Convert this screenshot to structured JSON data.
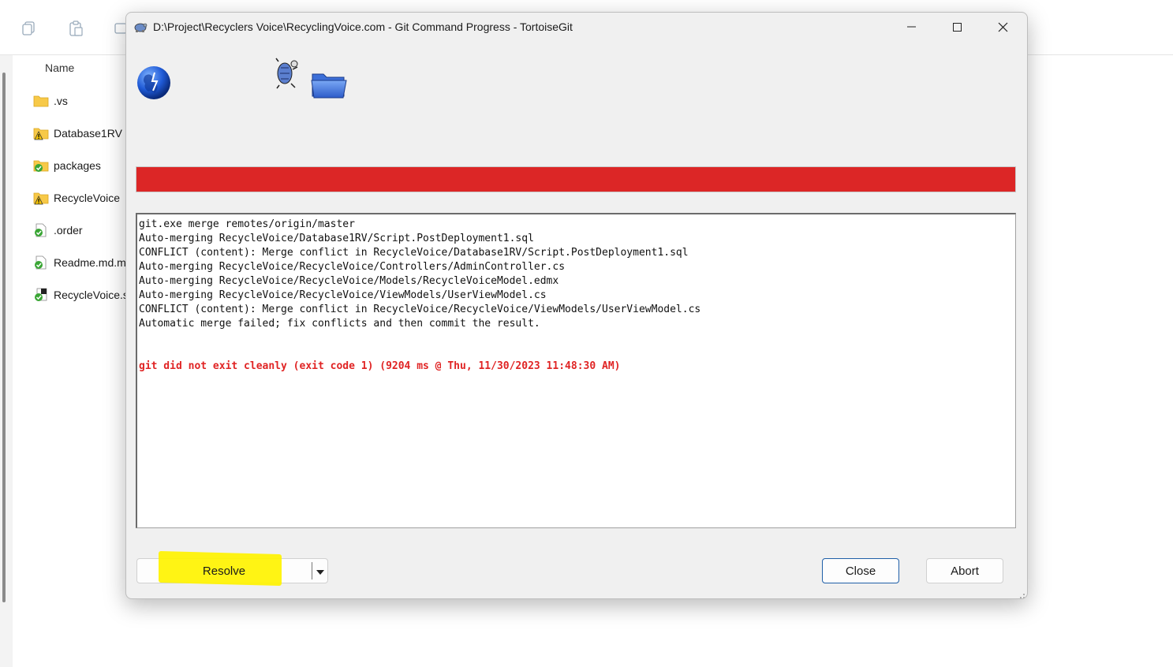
{
  "explorer": {
    "column_header": "Name",
    "files": [
      {
        "name": ".vs",
        "icon": "folder-icon"
      },
      {
        "name": "Database1RV",
        "icon": "folder-conflict-icon"
      },
      {
        "name": "packages",
        "icon": "folder-ok-icon"
      },
      {
        "name": "RecycleVoice",
        "icon": "folder-conflict-icon"
      },
      {
        "name": ".order",
        "icon": "file-ok-icon"
      },
      {
        "name": "Readme.md.m",
        "icon": "file-ok-icon"
      },
      {
        "name": "RecycleVoice.s",
        "icon": "solution-ok-icon"
      }
    ]
  },
  "dialog": {
    "title": "D:\\Project\\Recyclers Voice\\RecyclingVoice.com - Git Command Progress - TortoiseGit",
    "progress_color": "#dc2626",
    "log_lines": [
      "git.exe merge remotes/origin/master",
      "Auto-merging RecycleVoice/Database1RV/Script.PostDeployment1.sql",
      "CONFLICT (content): Merge conflict in RecycleVoice/Database1RV/Script.PostDeployment1.sql",
      "Auto-merging RecycleVoice/RecycleVoice/Controllers/AdminController.cs",
      "Auto-merging RecycleVoice/RecycleVoice/Models/RecycleVoiceModel.edmx",
      "Auto-merging RecycleVoice/RecycleVoice/ViewModels/UserViewModel.cs",
      "CONFLICT (content): Merge conflict in RecycleVoice/RecycleVoice/ViewModels/UserViewModel.cs",
      "Automatic merge failed; fix conflicts and then commit the result."
    ],
    "error_line": "git did not exit cleanly (exit code 1) (9204 ms @ Thu, 11/30/2023 11:48:30 AM)",
    "buttons": {
      "resolve": "Resolve",
      "close": "Close",
      "abort": "Abort"
    }
  }
}
